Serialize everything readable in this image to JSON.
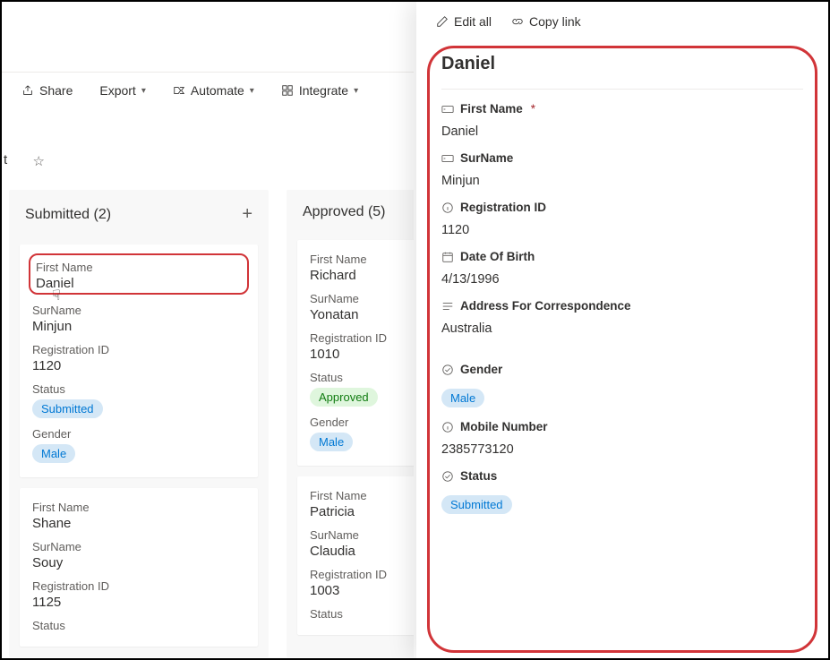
{
  "toolbar": {
    "share": "Share",
    "export": "Export",
    "automate": "Automate",
    "integrate": "Integrate"
  },
  "leftEdgeLetter": "t",
  "columns": {
    "submitted": {
      "title": "Submitted (2)",
      "cards": [
        {
          "firstName_lbl": "First Name",
          "firstName": "Daniel",
          "surname_lbl": "SurName",
          "surname": "Minjun",
          "regId_lbl": "Registration ID",
          "regId": "1120",
          "status_lbl": "Status",
          "status": "Submitted",
          "gender_lbl": "Gender",
          "gender": "Male"
        },
        {
          "firstName_lbl": "First Name",
          "firstName": "Shane",
          "surname_lbl": "SurName",
          "surname": "Souy",
          "regId_lbl": "Registration ID",
          "regId": "1125",
          "status_lbl": "Status"
        }
      ]
    },
    "approved": {
      "title": "Approved (5)",
      "cards": [
        {
          "firstName_lbl": "First Name",
          "firstName": "Richard",
          "surname_lbl": "SurName",
          "surname": "Yonatan",
          "regId_lbl": "Registration ID",
          "regId": "1010",
          "status_lbl": "Status",
          "status": "Approved",
          "gender_lbl": "Gender",
          "gender": "Male"
        },
        {
          "firstName_lbl": "First Name",
          "firstName": "Patricia",
          "surname_lbl": "SurName",
          "surname": "Claudia",
          "regId_lbl": "Registration ID",
          "regId": "1003",
          "status_lbl": "Status"
        }
      ]
    }
  },
  "panel": {
    "editAll": "Edit all",
    "copyLink": "Copy link",
    "title": "Daniel",
    "fields": {
      "firstName_lbl": "First Name",
      "firstName": "Daniel",
      "surname_lbl": "SurName",
      "surname": "Minjun",
      "regId_lbl": "Registration ID",
      "regId": "1120",
      "dob_lbl": "Date Of Birth",
      "dob": "4/13/1996",
      "address_lbl": "Address For Correspondence",
      "address": "Australia",
      "gender_lbl": "Gender",
      "gender": "Male",
      "mobile_lbl": "Mobile Number",
      "mobile": "2385773120",
      "status_lbl": "Status",
      "status": "Submitted"
    }
  }
}
